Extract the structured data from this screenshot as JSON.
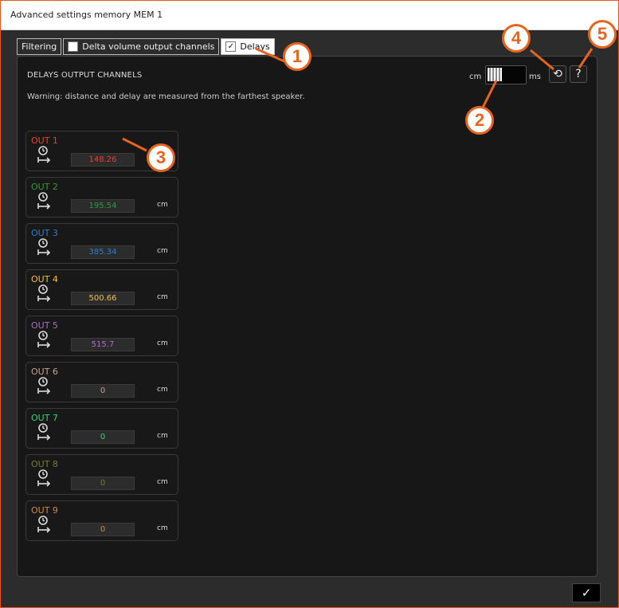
{
  "window": {
    "title": "Advanced settings memory MEM 1"
  },
  "tabs": [
    {
      "label": "Filtering",
      "checkbox": false,
      "checked": false,
      "active": false
    },
    {
      "label": "Delta volume output channels",
      "checkbox": true,
      "checked": false,
      "active": false
    },
    {
      "label": "Delays",
      "checkbox": true,
      "checked": true,
      "active": true
    }
  ],
  "panel": {
    "heading": "DELAYS OUTPUT CHANNELS",
    "warning": "Warning: distance and delay are measured from the farthest speaker.",
    "unit_toggle": {
      "left_label": "cm",
      "right_label": "ms",
      "selected": "cm"
    },
    "icons": {
      "reset": "reset-icon",
      "help": "help-icon"
    }
  },
  "channels": [
    {
      "label": "OUT 1",
      "value": "148.26",
      "unit": "cm",
      "color": "#e8402e"
    },
    {
      "label": "OUT 2",
      "value": "195.54",
      "unit": "cm",
      "color": "#2e9a3e"
    },
    {
      "label": "OUT 3",
      "value": "385.34",
      "unit": "cm",
      "color": "#2e7ec8"
    },
    {
      "label": "OUT 4",
      "value": "500.66",
      "unit": "cm",
      "color": "#f2c23a"
    },
    {
      "label": "OUT 5",
      "value": "515.7",
      "unit": "cm",
      "color": "#a870c8"
    },
    {
      "label": "OUT 6",
      "value": "0",
      "unit": "cm",
      "color": "#c8a090"
    },
    {
      "label": "OUT 7",
      "value": "0",
      "unit": "cm",
      "color": "#38d07a"
    },
    {
      "label": "OUT 8",
      "value": "0",
      "unit": "cm",
      "color": "#7a7a2a"
    },
    {
      "label": "OUT 9",
      "value": "0",
      "unit": "cm",
      "color": "#d08a36"
    }
  ],
  "footer": {
    "ok_label": "✓"
  },
  "callouts": [
    "1",
    "2",
    "3",
    "4",
    "5"
  ],
  "colors": {
    "callout": "#e8641e"
  }
}
